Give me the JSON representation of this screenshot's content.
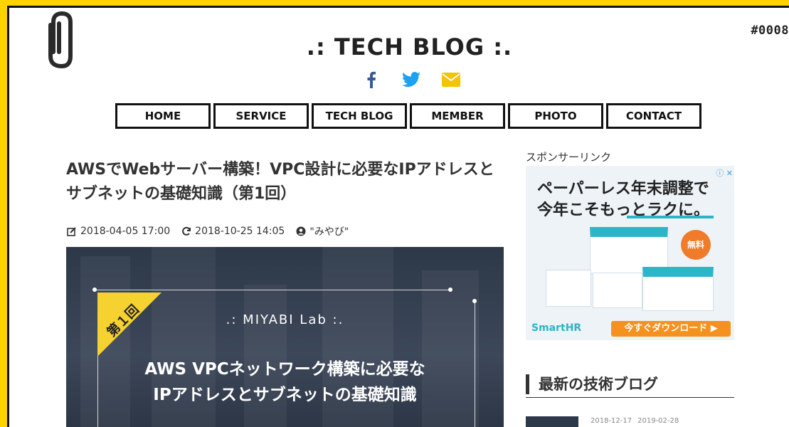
{
  "page_number": "#0008",
  "site": {
    "title": ".: TECH BLOG :."
  },
  "social": {
    "facebook": "facebook-icon",
    "twitter": "twitter-icon",
    "mail": "mail-icon"
  },
  "nav": [
    "HOME",
    "SERVICE",
    "TECH BLOG",
    "MEMBER",
    "PHOTO",
    "CONTACT"
  ],
  "article": {
    "title": "AWSでWebサーバー構築！VPC設計に必要なIPアドレスとサブネットの基礎知識（第1回）",
    "posted": "2018-04-05 17:00",
    "updated": "2018-10-25 14:05",
    "author": "\"みやび\""
  },
  "eyecatch": {
    "badge": "第１回",
    "lab": ".: MIYABI Lab :.",
    "heading1": "AWS VPCネットワーク構築に必要な",
    "heading2": "IPアドレスとサブネットの基礎知識"
  },
  "sidebar": {
    "sponsor_label": "スポンサーリンク",
    "ad": {
      "line1": "ペーパーレス年末調整で",
      "line2": "今年こそもっとラクに。",
      "free": "無料",
      "logo": "SmartHR",
      "cta": "今すぐダウンロード ▶",
      "info": "ⓘ ✕"
    },
    "latest_heading": "最新の技術ブログ",
    "latest_posted": "2018-12-17",
    "latest_updated": "2019-02-28"
  },
  "colors": {
    "frame": "#ffd200",
    "facebook": "#3b5998",
    "twitter": "#1da1f2",
    "mail": "#f5c400"
  }
}
